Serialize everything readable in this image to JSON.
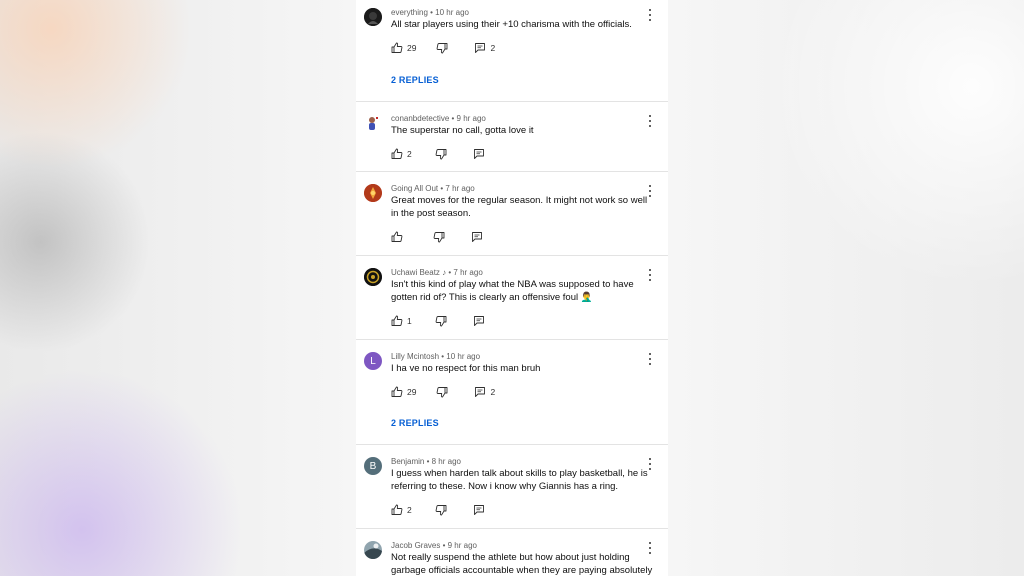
{
  "comments": [
    {
      "author": "everything",
      "time": "10 hr ago",
      "text": "All star players using their +10 charisma with the officials.",
      "likes": "29",
      "replies_count": "2",
      "replies_label": "2 REPLIES"
    },
    {
      "author": "conanbdetective",
      "time": "9 hr ago",
      "text": "The superstar no call, gotta love it",
      "likes": "2"
    },
    {
      "author": "Going All Out",
      "time": "7 hr ago",
      "text": "Great moves for the regular season. It might not work so well in the post season."
    },
    {
      "author": "Uchawi Beatz",
      "time": "7 hr ago",
      "text": "Isn't this kind of play what the NBA was supposed to have gotten rid of? This is clearly an offensive foul 🤦‍♂️",
      "likes": "1"
    },
    {
      "author": "Lilly Mcintosh",
      "time": "10 hr ago",
      "avatar_letter": "L",
      "avatar_color": "#7e57c2",
      "text": "I ha ve no respect for this man bruh",
      "likes": "29",
      "replies_count": "2",
      "replies_label": "2 REPLIES"
    },
    {
      "author": "Benjamin",
      "time": "8 hr ago",
      "avatar_letter": "B",
      "avatar_color": "#546e7a",
      "text": "I guess when harden talk about skills to play basketball, he is referring to these. Now i know why Giannis has a ring.",
      "likes": "2"
    },
    {
      "author": "Jacob Graves",
      "time": "9 hr ago",
      "text": "Not really suspend the athlete but how about just holding garbage officials accountable when they are paying absolutely no"
    }
  ],
  "separator": " • ",
  "music_note": "♪",
  "colors": {
    "link": "#065fd4",
    "text": "#0f0f0f",
    "meta": "#606060"
  }
}
